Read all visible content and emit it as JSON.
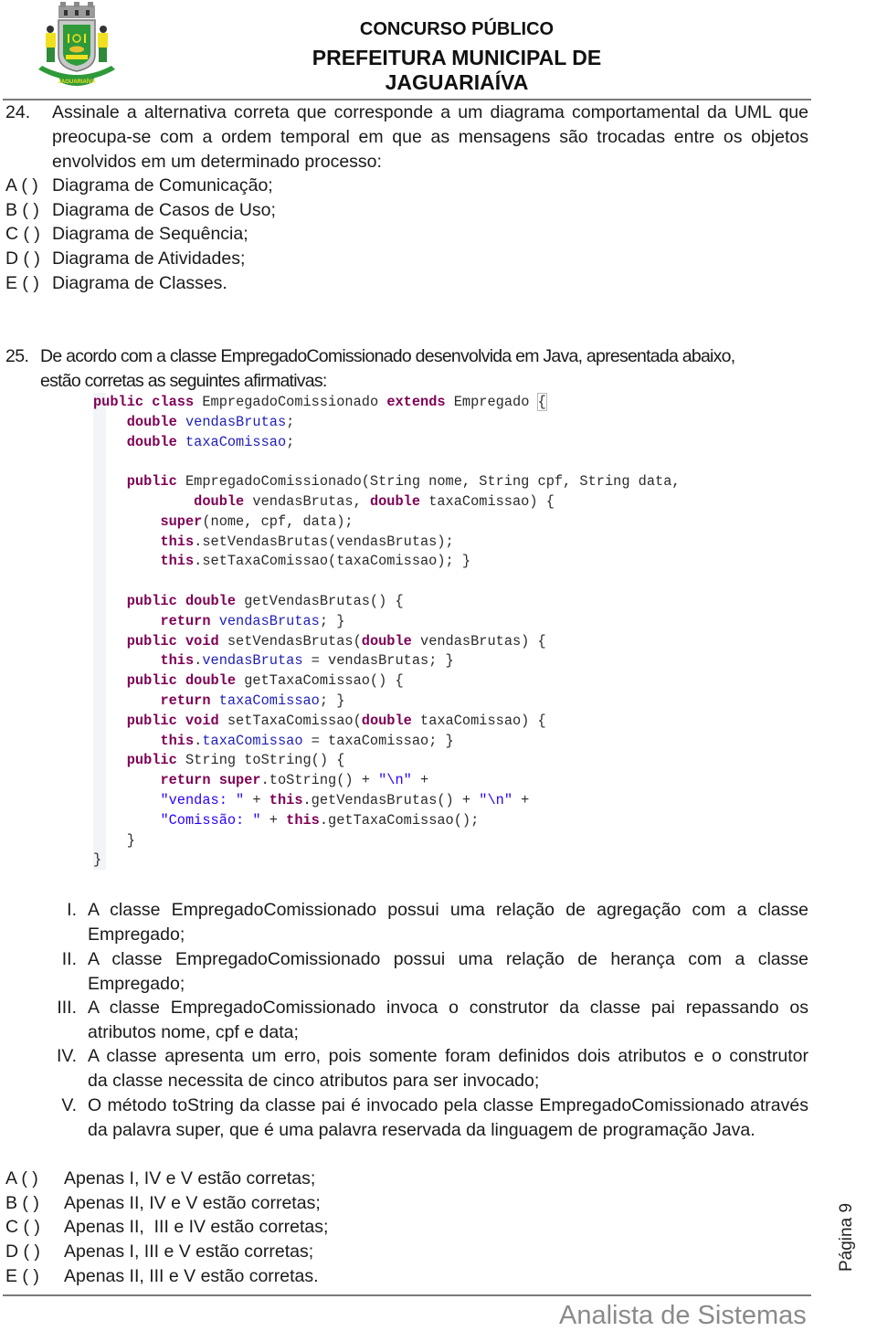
{
  "header": {
    "crest_icon": "municipal-coat-of-arms",
    "crest_text": "JAGUARIAÍVA",
    "line1": "CONCURSO PÚBLICO",
    "line2": "PREFEITURA MUNICIPAL DE JAGUARIAÍVA"
  },
  "q24": {
    "number": "24.",
    "lines": [
      "Assinale a alternativa correta que corresponde a um diagrama comportamental da UML que",
      "preocupa-se com a ordem temporal em que as mensagens são trocadas entre os objetos",
      "envolvidos em um determinado processo:"
    ],
    "options": [
      {
        "letter": "A (   )",
        "text": "Diagrama de Comunicação;"
      },
      {
        "letter": "B (   )",
        "text": "Diagrama de Casos de Uso;"
      },
      {
        "letter": "C (   )",
        "text": "Diagrama de Sequência;"
      },
      {
        "letter": "D (   )",
        "text": "Diagrama de Atividades;"
      },
      {
        "letter": "E (   )",
        "text": "Diagrama de Classes."
      }
    ]
  },
  "q25": {
    "number": "25.",
    "lines": [
      "De acordo com a classe EmpregadoComissionado desenvolvida em Java, apresentada abaixo,",
      "estão corretas as seguintes afirmativas:"
    ],
    "code": [
      "public class EmpregadoComissionado extends Empregado {",
      "    double vendasBrutas;",
      "    double taxaComissao;",
      "",
      "    public EmpregadoComissionado(String nome, String cpf, String data,",
      "            double vendasBrutas, double taxaComissao) {",
      "        super(nome, cpf, data);",
      "        this.setVendasBrutas(vendasBrutas);",
      "        this.setTaxaComissao(taxaComissao); }",
      "",
      "    public double getVendasBrutas() {",
      "        return vendasBrutas; }",
      "    public void setVendasBrutas(double vendasBrutas) {",
      "        this.vendasBrutas = vendasBrutas; }",
      "    public double getTaxaComissao() {",
      "        return taxaComissao; }",
      "    public void setTaxaComissao(double taxaComissao) {",
      "        this.taxaComissao = taxaComissao; }",
      "    public String toString() {",
      "        return super.toString() + \"\\n\" +",
      "        \"vendas: \" + this.getVendasBrutas() + \"\\n\" +",
      "        \"Comissão: \" + this.getTaxaComissao();",
      "    }",
      "}"
    ],
    "statements": [
      {
        "num": "I.",
        "lines": [
          "A classe EmpregadoComissionado possui uma relação de agregação com a classe",
          "Empregado;"
        ]
      },
      {
        "num": "II.",
        "lines": [
          "A classe EmpregadoComissionado possui uma relação de herança com a classe",
          "Empregado;"
        ]
      },
      {
        "num": "III.",
        "lines": [
          "A classe EmpregadoComissionado invoca o construtor da classe pai repassando os",
          "atributos nome, cpf e data;"
        ]
      },
      {
        "num": "IV.",
        "lines": [
          "A classe apresenta um erro, pois somente foram definidos dois atributos e o construtor",
          "da classe necessita de cinco atributos para ser invocado;"
        ]
      },
      {
        "num": "V.",
        "lines": [
          "O método toString da classe pai é invocado pela classe EmpregadoComissionado através",
          "da palavra super, que é uma palavra reservada da linguagem de programação Java."
        ]
      }
    ],
    "options": [
      {
        "letter": "A (   )",
        "text": "Apenas I, IV e V estão corretas;"
      },
      {
        "letter": "B (   )",
        "text": "Apenas II, IV e V estão corretas;"
      },
      {
        "letter": "C (   )",
        "text": "Apenas II,  III e IV estão corretas;"
      },
      {
        "letter": "D (   )",
        "text": "Apenas I, III e V estão corretas;"
      },
      {
        "letter": "E (   )",
        "text": "Apenas II, III e V estão corretas."
      }
    ]
  },
  "footer": {
    "title": "Analista de Sistemas",
    "page": "Página 9"
  }
}
